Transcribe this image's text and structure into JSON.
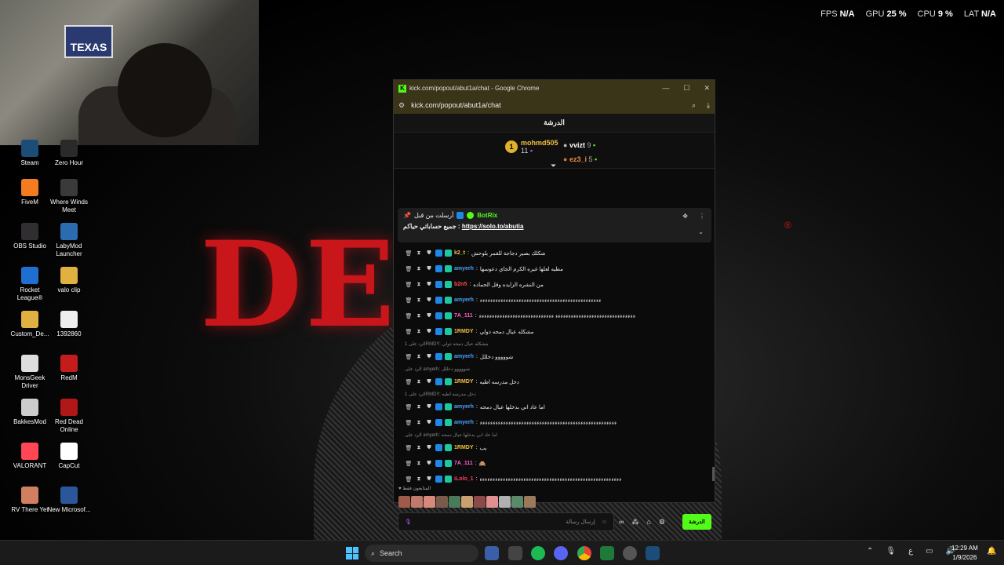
{
  "wallpaper": {
    "title": "DEV   R",
    "reg": "®"
  },
  "webcam": {
    "sign_text": "TEXAS"
  },
  "hud": {
    "fps_label": "FPS",
    "fps_value": "N/A",
    "gpu_label": "GPU",
    "gpu_value": "25 %",
    "cpu_label": "CPU",
    "cpu_value": "9 %",
    "lat_label": "LAT",
    "lat_value": "N/A"
  },
  "desktop_icons": [
    {
      "label": "Steam",
      "color": "#1b4d78"
    },
    {
      "label": "Zero Hour",
      "color": "#2a2a2a"
    },
    {
      "label": "FiveM",
      "color": "#f47c20"
    },
    {
      "label": "Where Winds Meet",
      "color": "#3a3a3a"
    },
    {
      "label": "OBS Studio",
      "color": "#302e31"
    },
    {
      "label": "LabyMod Launcher",
      "color": "#2b6cb0"
    },
    {
      "label": "Rocket League®",
      "color": "#1f6fd1"
    },
    {
      "label": "valo clip",
      "color": "#e0b040"
    },
    {
      "label": "Custom_De...",
      "color": "#e0b040"
    },
    {
      "label": "1392860",
      "color": "#eeeeee"
    },
    {
      "label": "MonsGeek Driver",
      "color": "#dddddd"
    },
    {
      "label": "RedM",
      "color": "#c41c1c"
    },
    {
      "label": "BakkesMod",
      "color": "#cccccc"
    },
    {
      "label": "Red Dead Online",
      "color": "#b01818"
    },
    {
      "label": "VALORANT",
      "color": "#ff4655"
    },
    {
      "label": "CapCut",
      "color": "#ffffff"
    },
    {
      "label": "RV There Yet",
      "color": "#d08060"
    },
    {
      "label": "New Microsof...",
      "color": "#2b579a"
    }
  ],
  "browser": {
    "title": "kick.com/popout/abut1a/chat - Google Chrome",
    "url": "kick.com/popout/abut1a/chat",
    "favicon": "K"
  },
  "chat": {
    "header": "الدرشة",
    "leaderboard": {
      "first": {
        "rank": "1",
        "name": "mohmd505",
        "count": "11"
      },
      "second": {
        "name": "vvizt",
        "count": "9"
      },
      "third": {
        "name": "ez3_i",
        "count": "5"
      }
    },
    "pinned": {
      "sent_by": "أرسلت من قبل",
      "author": "BotRix",
      "text": "جميع حساباتي حياكم",
      "link": "https://solo.to/abutia"
    },
    "messages": [
      {
        "user": "k2_t",
        "color": "#f0c040",
        "text": "شكلك بصير دجاجة للقمر بلوحش"
      },
      {
        "user": "amyerh",
        "color": "#4aa3ff",
        "text": "مطيه لعلها غيره الكرم الجاي دعوسها"
      },
      {
        "user": "b2n5",
        "color": "#ff4b4b",
        "text": "من النشره الزايده وقل الحماده"
      },
      {
        "user": "amyerh",
        "color": "#4aa3ff",
        "text": "ءءءءءءءءءءءءءءءءءءءءءءءءءءءءءءءءءءءءءءءءءءءءءءء"
      },
      {
        "user": "7A_111",
        "color": "#ff5fd0",
        "text": "ءءءءءءءءءءءءءءءءءءءءءءءءءءءءءءء ءءءءءءءءءءءءءءءءءءءءءءءءءءءءء"
      },
      {
        "user": "1RMDY",
        "color": "#f0c040",
        "text": "مشكله عيال دمحه ذولي"
      },
      {
        "reply": "الرد على 1RMDY: مشكله عيال دمحه ذولي"
      },
      {
        "user": "amyerh",
        "color": "#4aa3ff",
        "text": "شووووو دخللل"
      },
      {
        "reply": "الرد على amyerh: شووووو دخللل"
      },
      {
        "user": "1RMDY",
        "color": "#f0c040",
        "text": "دخل مدرسه اطيه"
      },
      {
        "reply": "الرد على 1RMDY: دخل مدرسه اطيه"
      },
      {
        "user": "amyerh",
        "color": "#4aa3ff",
        "text": "اما عاد اني بدخلها عيال دمحه"
      },
      {
        "user": "amyerh",
        "color": "#4aa3ff",
        "text": "ءءءءءءءءءءءءءءءءءءءءءءءءءءءءءءءءءءءءءءءءءءءءءءءءءءءءء"
      },
      {
        "reply": "الرد على amyerh: اما عاد اني بدخلها عيال دمحه"
      },
      {
        "user": "1RMDY",
        "color": "#f0c040",
        "text": "يب"
      },
      {
        "user": "7A_111",
        "color": "#ff5fd0",
        "text": "🙈"
      },
      {
        "user": "iLolo_1",
        "color": "#ff3b6b",
        "text": "ءءءءءءءءءءءءءءءءءءءءءءءءءءءءءءءءءءءءءءءءءءءءءءءءءءءءءءء"
      }
    ],
    "typing_label": "المتابعون فقط",
    "input_placeholder": "إرسال رسالة",
    "send_label": "الدرشة"
  },
  "taskbar": {
    "search_label": "Search",
    "time": "12:29 AM",
    "date": "1/9/2026",
    "lang": "ع"
  }
}
